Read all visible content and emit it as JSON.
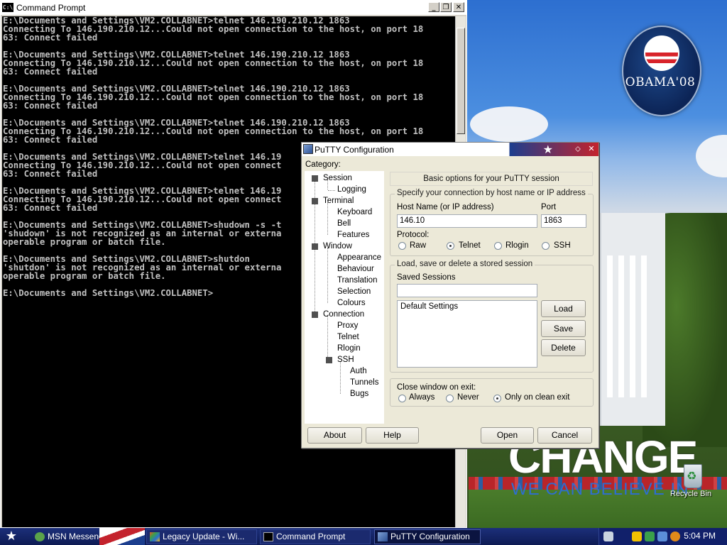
{
  "command_prompt": {
    "title": "Command Prompt",
    "icon_text": "C:\\",
    "output": "E:\\Documents and Settings\\VM2.COLLABNET>telnet 146.190.210.12 1863\nConnecting To 146.190.210.12...Could not open connection to the host, on port 18\n63: Connect failed\n\nE:\\Documents and Settings\\VM2.COLLABNET>telnet 146.190.210.12 1863\nConnecting To 146.190.210.12...Could not open connection to the host, on port 18\n63: Connect failed\n\nE:\\Documents and Settings\\VM2.COLLABNET>telnet 146.190.210.12 1863\nConnecting To 146.190.210.12...Could not open connection to the host, on port 18\n63: Connect failed\n\nE:\\Documents and Settings\\VM2.COLLABNET>telnet 146.190.210.12 1863\nConnecting To 146.190.210.12...Could not open connection to the host, on port 18\n63: Connect failed\n\nE:\\Documents and Settings\\VM2.COLLABNET>telnet 146.19\nConnecting To 146.190.210.12...Could not open connect\n63: Connect failed\n\nE:\\Documents and Settings\\VM2.COLLABNET>telnet 146.19\nConnecting To 146.190.210.12...Could not open connect\n63: Connect failed\n\nE:\\Documents and Settings\\VM2.COLLABNET>shudown -s -t\n'shudown' is not recognized as an internal or externa\noperable program or batch file.\n\nE:\\Documents and Settings\\VM2.COLLABNET>shutdon\n'shutdon' is not recognized as an internal or externa\noperable program or batch file.\n\nE:\\Documents and Settings\\VM2.COLLABNET>"
  },
  "putty": {
    "title": "PuTTY Configuration",
    "category_label": "Category:",
    "tree": {
      "session": "Session",
      "logging": "Logging",
      "terminal": "Terminal",
      "keyboard": "Keyboard",
      "bell": "Bell",
      "features": "Features",
      "window": "Window",
      "appearance": "Appearance",
      "behaviour": "Behaviour",
      "translation": "Translation",
      "selection": "Selection",
      "colours": "Colours",
      "connection": "Connection",
      "proxy": "Proxy",
      "telnet": "Telnet",
      "rlogin": "Rlogin",
      "ssh": "SSH",
      "auth": "Auth",
      "tunnels": "Tunnels",
      "bugs": "Bugs"
    },
    "banner": "Basic options for your PuTTY session",
    "dest_group": "Specify your connection by host name or IP address",
    "host_label": "Host Name (or IP address)",
    "host_value": "146.10",
    "port_label": "Port",
    "port_value": "1863",
    "protocol_label": "Protocol:",
    "protocols": {
      "raw": "Raw",
      "telnet": "Telnet",
      "rlogin": "Rlogin",
      "ssh": "SSH"
    },
    "selected_protocol": "Telnet",
    "sessions_group": "Load, save or delete a stored session",
    "saved_sessions_label": "Saved Sessions",
    "saved_sessions_value": "",
    "sessions_list": [
      "Default Settings"
    ],
    "load": "Load",
    "save": "Save",
    "delete": "Delete",
    "close_label": "Close window on exit:",
    "close_options": {
      "always": "Always",
      "never": "Never",
      "clean": "Only on clean exit"
    },
    "selected_close": "Only on clean exit",
    "about": "About",
    "help": "Help",
    "open": "Open",
    "cancel": "Cancel"
  },
  "desktop": {
    "logo_text": "OBAMA'08",
    "slogan": "CHANGE",
    "tagline": "WE CAN BELIEVE IN",
    "recycle_bin": "Recycle Bin"
  },
  "taskbar": {
    "tasks": [
      "MSN Messenger",
      "Legacy Update - Wi...",
      "Command Prompt",
      "PuTTY Configuration"
    ],
    "active_task": "PuTTY Configuration",
    "clock": "5:04 PM"
  },
  "colors": {
    "console_bg": "#000000",
    "console_fg": "#c0c0c0",
    "taskbar": "#1c2f7a",
    "accent_red": "#c4232d"
  }
}
